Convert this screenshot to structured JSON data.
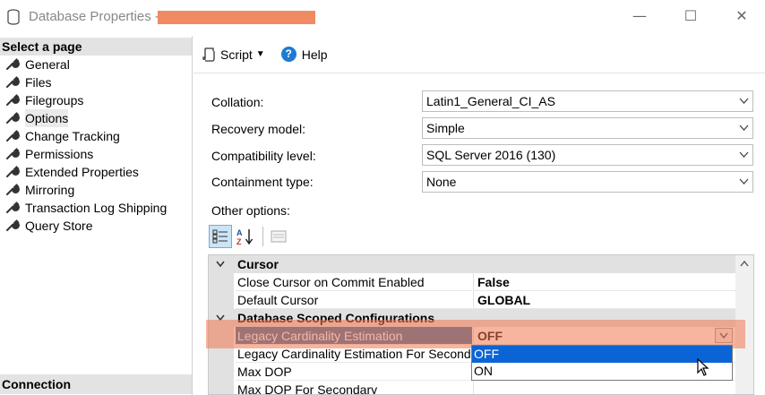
{
  "window": {
    "title": "Database Properties - ",
    "minimize": "—",
    "maximize": "☐",
    "close": "✕"
  },
  "left_pane": {
    "select_page_header": "Select a page",
    "pages": [
      {
        "label": "General"
      },
      {
        "label": "Files"
      },
      {
        "label": "Filegroups"
      },
      {
        "label": "Options",
        "selected": true
      },
      {
        "label": "Change Tracking"
      },
      {
        "label": "Permissions"
      },
      {
        "label": "Extended Properties"
      },
      {
        "label": "Mirroring"
      },
      {
        "label": "Transaction Log Shipping"
      },
      {
        "label": "Query Store"
      }
    ],
    "connection_header": "Connection"
  },
  "toolbar": {
    "script_label": "Script",
    "help_label": "Help"
  },
  "form": {
    "collation_label": "Collation:",
    "collation_value": "Latin1_General_CI_AS",
    "recovery_label": "Recovery model:",
    "recovery_value": "Simple",
    "compat_label": "Compatibility level:",
    "compat_value": "SQL Server 2016 (130)",
    "containment_label": "Containment type:",
    "containment_value": "None",
    "other_options_label": "Other options:"
  },
  "property_grid": {
    "categories": [
      {
        "name": "Cursor",
        "rows": [
          {
            "name": "Close Cursor on Commit Enabled",
            "value": "False"
          },
          {
            "name": "Default Cursor",
            "value": "GLOBAL"
          }
        ]
      },
      {
        "name": "Database Scoped Configurations",
        "rows": [
          {
            "name": "Legacy Cardinality Estimation",
            "value": "OFF",
            "selected": true
          },
          {
            "name": "Legacy Cardinality Estimation For Secondary",
            "value": ""
          },
          {
            "name": "Max DOP",
            "value": ""
          },
          {
            "name": "Max DOP For Secondary",
            "value": ""
          }
        ]
      }
    ],
    "dropdown_options": [
      "OFF",
      "ON"
    ],
    "dropdown_selected": "OFF"
  },
  "colors": {
    "selection_blue": "#3a6ea5",
    "dropdown_highlight": "#0a64d6",
    "annotation_orange": "#f08a62",
    "category_gray": "#e1e1e1"
  }
}
